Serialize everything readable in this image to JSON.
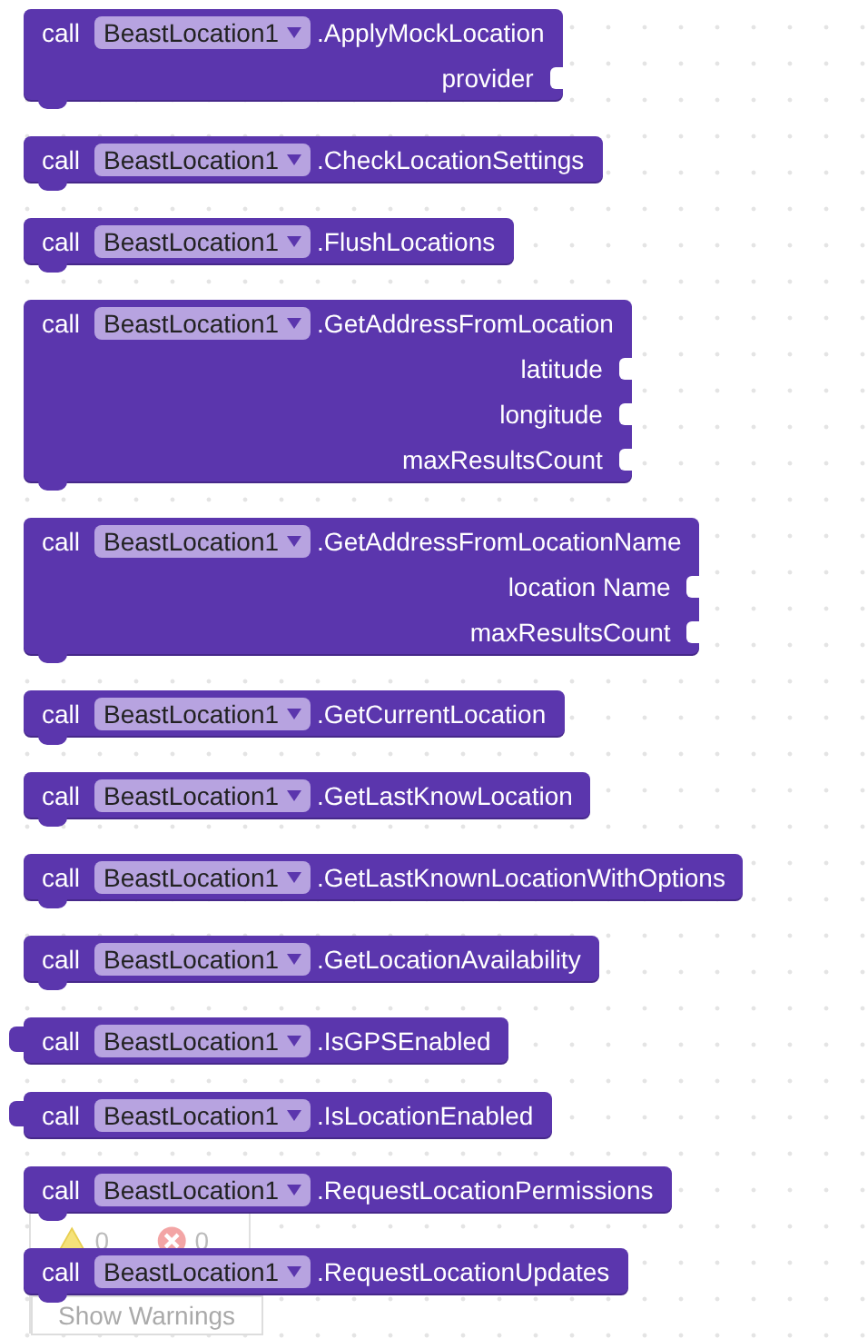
{
  "blocks": [
    {
      "kind": "statement",
      "keyword": "call",
      "component": "BeastLocation1",
      "method": ".ApplyMockLocation",
      "params": [
        "provider"
      ]
    },
    {
      "kind": "statement",
      "keyword": "call",
      "component": "BeastLocation1",
      "method": ".CheckLocationSettings"
    },
    {
      "kind": "statement",
      "keyword": "call",
      "component": "BeastLocation1",
      "method": ".FlushLocations"
    },
    {
      "kind": "statement",
      "keyword": "call",
      "component": "BeastLocation1",
      "method": ".GetAddressFromLocation",
      "params": [
        "latitude",
        "longitude",
        "maxResultsCount"
      ]
    },
    {
      "kind": "statement",
      "keyword": "call",
      "component": "BeastLocation1",
      "method": ".GetAddressFromLocationName",
      "params": [
        "location Name",
        "maxResultsCount"
      ]
    },
    {
      "kind": "statement",
      "keyword": "call",
      "component": "BeastLocation1",
      "method": ".GetCurrentLocation"
    },
    {
      "kind": "statement",
      "keyword": "call",
      "component": "BeastLocation1",
      "method": ".GetLastKnowLocation"
    },
    {
      "kind": "statement",
      "keyword": "call",
      "component": "BeastLocation1",
      "method": ".GetLastKnownLocationWithOptions"
    },
    {
      "kind": "statement",
      "keyword": "call",
      "component": "BeastLocation1",
      "method": ".GetLocationAvailability"
    },
    {
      "kind": "value",
      "keyword": "call",
      "component": "BeastLocation1",
      "method": ".IsGPSEnabled"
    },
    {
      "kind": "value",
      "keyword": "call",
      "component": "BeastLocation1",
      "method": ".IsLocationEnabled"
    },
    {
      "kind": "statement",
      "keyword": "call",
      "component": "BeastLocation1",
      "method": ".RequestLocationPermissions"
    },
    {
      "kind": "statement",
      "keyword": "call",
      "component": "BeastLocation1",
      "method": ".RequestLocationUpdates"
    }
  ],
  "indicator": {
    "warnings": "0",
    "errors": "0",
    "button": "Show Warnings"
  }
}
